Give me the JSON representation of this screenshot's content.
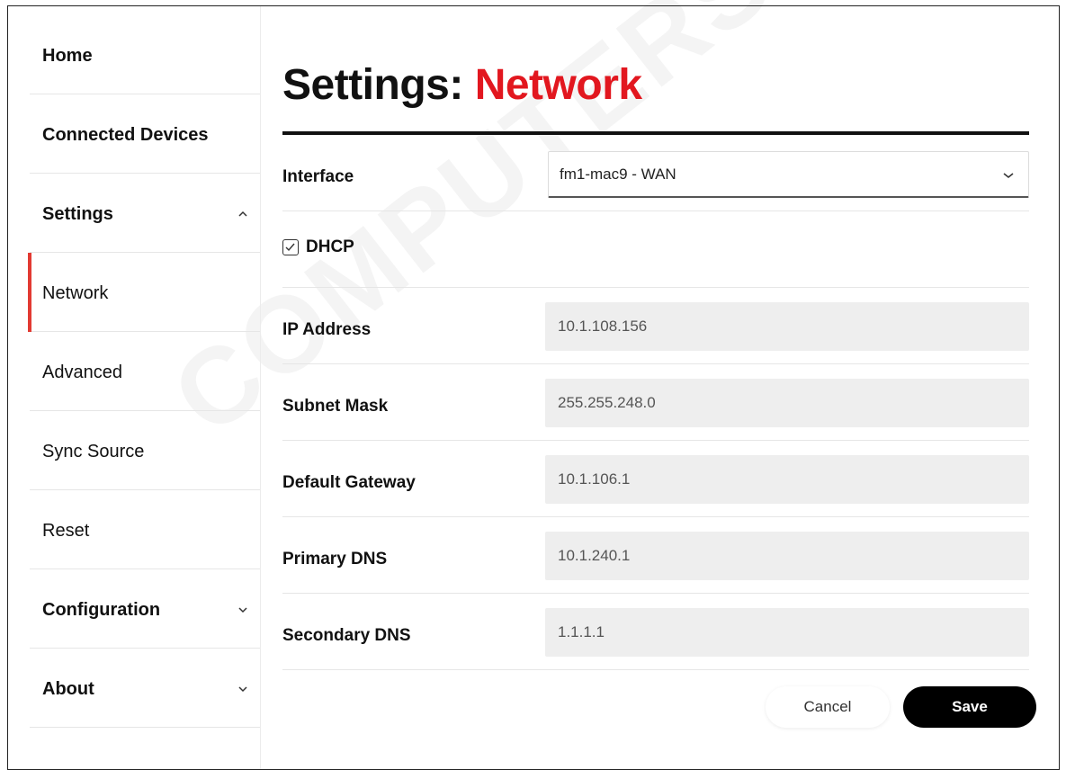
{
  "sidebar": {
    "items": [
      {
        "label": "Home"
      },
      {
        "label": "Connected Devices"
      },
      {
        "label": "Settings",
        "chevron": "^"
      },
      {
        "label": "Network"
      },
      {
        "label": "Advanced"
      },
      {
        "label": "Sync Source"
      },
      {
        "label": "Reset"
      },
      {
        "label": "Configuration",
        "chevron": "˅"
      },
      {
        "label": "About",
        "chevron": "˅"
      }
    ]
  },
  "page": {
    "title_prefix": "Settings:",
    "title_accent": "Network",
    "accent_color": "#e2171f"
  },
  "form": {
    "interface_label": "Interface",
    "interface_value": "fm1-mac9 - WAN",
    "dhcp_label": "DHCP",
    "dhcp_checked": true,
    "ip_label": "IP Address",
    "ip_value": "10.1.108.156",
    "subnet_label": "Subnet Mask",
    "subnet_value": "255.255.248.0",
    "gateway_label": "Default Gateway",
    "gateway_value": "10.1.106.1",
    "dns1_label": "Primary DNS",
    "dns1_value": "10.1.240.1",
    "dns2_label": "Secondary DNS",
    "dns2_value": "1.1.1.1"
  },
  "actions": {
    "cancel_label": "Cancel",
    "save_label": "Save"
  },
  "icons": {
    "chevron_down": "chevron-down-icon",
    "chevron_up": "chevron-up-icon",
    "checkmark": "checkmark-icon"
  }
}
